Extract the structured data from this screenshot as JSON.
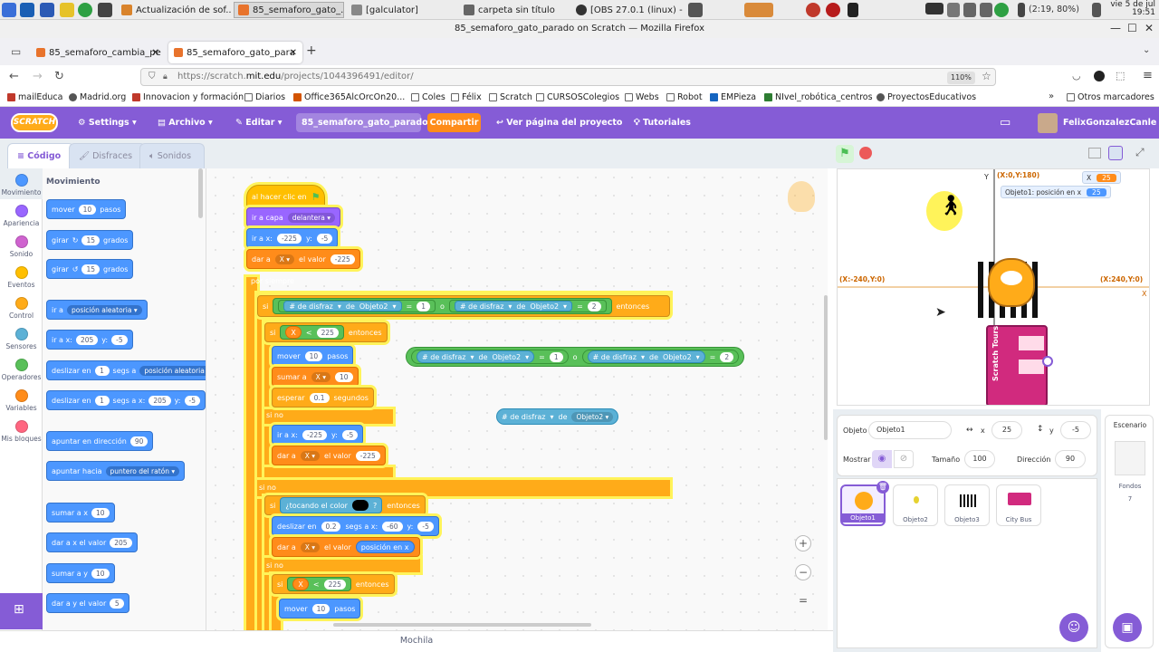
{
  "taskbar": {
    "tasks": [
      "Actualización de sof...",
      "85_semaforo_gato_...",
      "[galculator]",
      "carpeta sin título",
      "[OBS 27.0.1 (linux) - P..."
    ],
    "battery": "(2:19, 80%)",
    "clock_date": "vie 5 de jul",
    "clock_time": "19:51"
  },
  "firefox": {
    "window_title": "85_semaforo_gato_parado on Scratch — Mozilla Firefox",
    "tabs": [
      "85_semaforo_cambia_pe",
      "85_semaforo_gato_para"
    ],
    "url_prefix": "https://scratch.",
    "url_host": "mit.edu",
    "url_path": "/projects/1044396491/editor/",
    "zoom": "110%",
    "bookmarks": [
      "mailEduca",
      "Madrid.org",
      "Innovacion y formación",
      "Diarios",
      "Office365AlcOrcOn20...",
      "Coles",
      "Félix",
      "Scratch",
      "CURSOSColegios",
      "Webs",
      "Robot",
      "EMPieza",
      "NIvel_robótica_centros",
      "ProyectosEducativos"
    ],
    "other_bookmarks": "Otros marcadores"
  },
  "menubar": {
    "logo": "SCRATCH",
    "settings": "Settings",
    "file": "Archivo",
    "edit": "Editar",
    "project_title": "85_semaforo_gato_parado",
    "share": "Compartir",
    "see_project": "Ver página del proyecto",
    "tutorials": "Tutoriales",
    "username": "FelixGonzalezCanle"
  },
  "editor_tabs": {
    "code": "Código",
    "costumes": "Disfraces",
    "sounds": "Sonidos"
  },
  "categories": [
    {
      "label": "Movimiento",
      "color": "#4c97ff"
    },
    {
      "label": "Apariencia",
      "color": "#9966ff"
    },
    {
      "label": "Sonido",
      "color": "#cf63cf"
    },
    {
      "label": "Eventos",
      "color": "#ffbf00"
    },
    {
      "label": "Control",
      "color": "#ffab19"
    },
    {
      "label": "Sensores",
      "color": "#5cb1d6"
    },
    {
      "label": "Operadores",
      "color": "#59c059"
    },
    {
      "label": "Variables",
      "color": "#ff8c1a"
    },
    {
      "label": "Mis bloques",
      "color": "#ff6680"
    }
  ],
  "palette": {
    "heading": "Movimiento",
    "b_move": {
      "a": "mover",
      "v": "10",
      "b": "pasos"
    },
    "b_turn_r": {
      "a": "girar",
      "v": "15",
      "b": "grados"
    },
    "b_turn_l": {
      "a": "girar",
      "v": "15",
      "b": "grados"
    },
    "b_goto": {
      "a": "ir a",
      "dd": "posición aleatoria"
    },
    "b_gotoxy": {
      "a": "ir a x:",
      "x": "205",
      "b": "y:",
      "y": "-5"
    },
    "b_glide": {
      "a": "deslizar en",
      "v": "1",
      "b": "segs a",
      "dd": "posición aleatoria"
    },
    "b_glidexy": {
      "a": "deslizar en",
      "v": "1",
      "b": "segs a x:",
      "x": "205",
      "c": "y:",
      "y": "-5"
    },
    "b_point": {
      "a": "apuntar en dirección",
      "v": "90"
    },
    "b_pointto": {
      "a": "apuntar hacia",
      "dd": "puntero del ratón"
    },
    "b_changex": {
      "a": "sumar a x",
      "v": "10"
    },
    "b_setx": {
      "a": "dar a x el valor",
      "v": "205"
    },
    "b_changey": {
      "a": "sumar a y",
      "v": "10"
    },
    "b_sety": {
      "a": "dar a y el valor",
      "v": "5"
    }
  },
  "script": {
    "hat": "al hacer clic en",
    "layer": {
      "a": "ir a capa",
      "dd": "delantera"
    },
    "gotoxy": {
      "a": "ir a x:",
      "x": "-225",
      "b": "y:",
      "y": "-5"
    },
    "setvar": {
      "a": "dar a",
      "var": "X",
      "b": "el valor",
      "v": "-225"
    },
    "forever": "por siempre",
    "if1": {
      "si": "si",
      "entonces": "entonces"
    },
    "cond1": {
      "a": "# de disfraz",
      "de": "de",
      "obj": "Objeto2",
      "eq": "=",
      "v1": "1",
      "o": "o",
      "v2": "2"
    },
    "if2": {
      "si": "si",
      "var": "X",
      "lt": "<",
      "v": "225",
      "entonces": "entonces"
    },
    "move": {
      "a": "mover",
      "v": "10",
      "b": "pasos"
    },
    "changevar": {
      "a": "sumar a",
      "var": "X",
      "v": "10"
    },
    "wait": {
      "a": "esperar",
      "v": "0.1",
      "b": "segundos"
    },
    "else1": "si no",
    "gotoxy2": {
      "a": "ir a x:",
      "x": "-225",
      "b": "y:",
      "y": "-5"
    },
    "setvar2": {
      "a": "dar a",
      "var": "X",
      "b": "el valor",
      "v": "-225"
    },
    "else_outer": "si no",
    "if3": {
      "si": "si",
      "q": "¿tocando el color",
      "end": "?",
      "entonces": "entonces"
    },
    "glide": {
      "a": "deslizar en",
      "v": "0.2",
      "b": "segs a x:",
      "x": "-60",
      "c": "y:",
      "y": "-5"
    },
    "setvar3": {
      "a": "dar a",
      "var": "X",
      "b": "el valor",
      "rep": "posición en x"
    },
    "else2": "si no",
    "if4": {
      "si": "si",
      "var": "X",
      "lt": "<",
      "v": "225",
      "entonces": "entonces"
    },
    "move2": {
      "a": "mover",
      "v": "10",
      "b": "pasos"
    },
    "floating_or": {
      "a": "# de disfraz",
      "de": "de",
      "obj": "Objeto2",
      "eq": "=",
      "v1": "1",
      "o": "o",
      "v2": "2"
    },
    "floating_rep": {
      "a": "# de disfraz",
      "de": "de",
      "obj": "Objeto2"
    }
  },
  "mochila": "Mochila",
  "stage": {
    "coord_top": "(X:0,Y:180)",
    "coord_left": "(X:-240,Y:0)",
    "coord_right": "(X:240,Y:0)",
    "axis_y": "Y",
    "axis_x": "X",
    "monitor_x_label": "X",
    "monitor_x_value": "25",
    "monitor_pos_label": "Objeto1: posición en x",
    "monitor_pos_value": "25",
    "bus_text": "Scratch Tours"
  },
  "sprite_info": {
    "sprite_label": "Objeto",
    "sprite_name": "Objeto1",
    "x_label": "x",
    "x": "25",
    "y_label": "y",
    "y": "-5",
    "show_label": "Mostrar",
    "size_label": "Tamaño",
    "size": "100",
    "dir_label": "Dirección",
    "dir": "90"
  },
  "sprites": [
    "Objeto1",
    "Objeto2",
    "Objeto3",
    "City Bus"
  ],
  "stage_panel": {
    "label": "Escenario",
    "backdrops_label": "Fondos",
    "backdrops_count": "7"
  },
  "colors": {
    "scratch_purple": "#855cd6",
    "highlight": "#fff35a"
  }
}
